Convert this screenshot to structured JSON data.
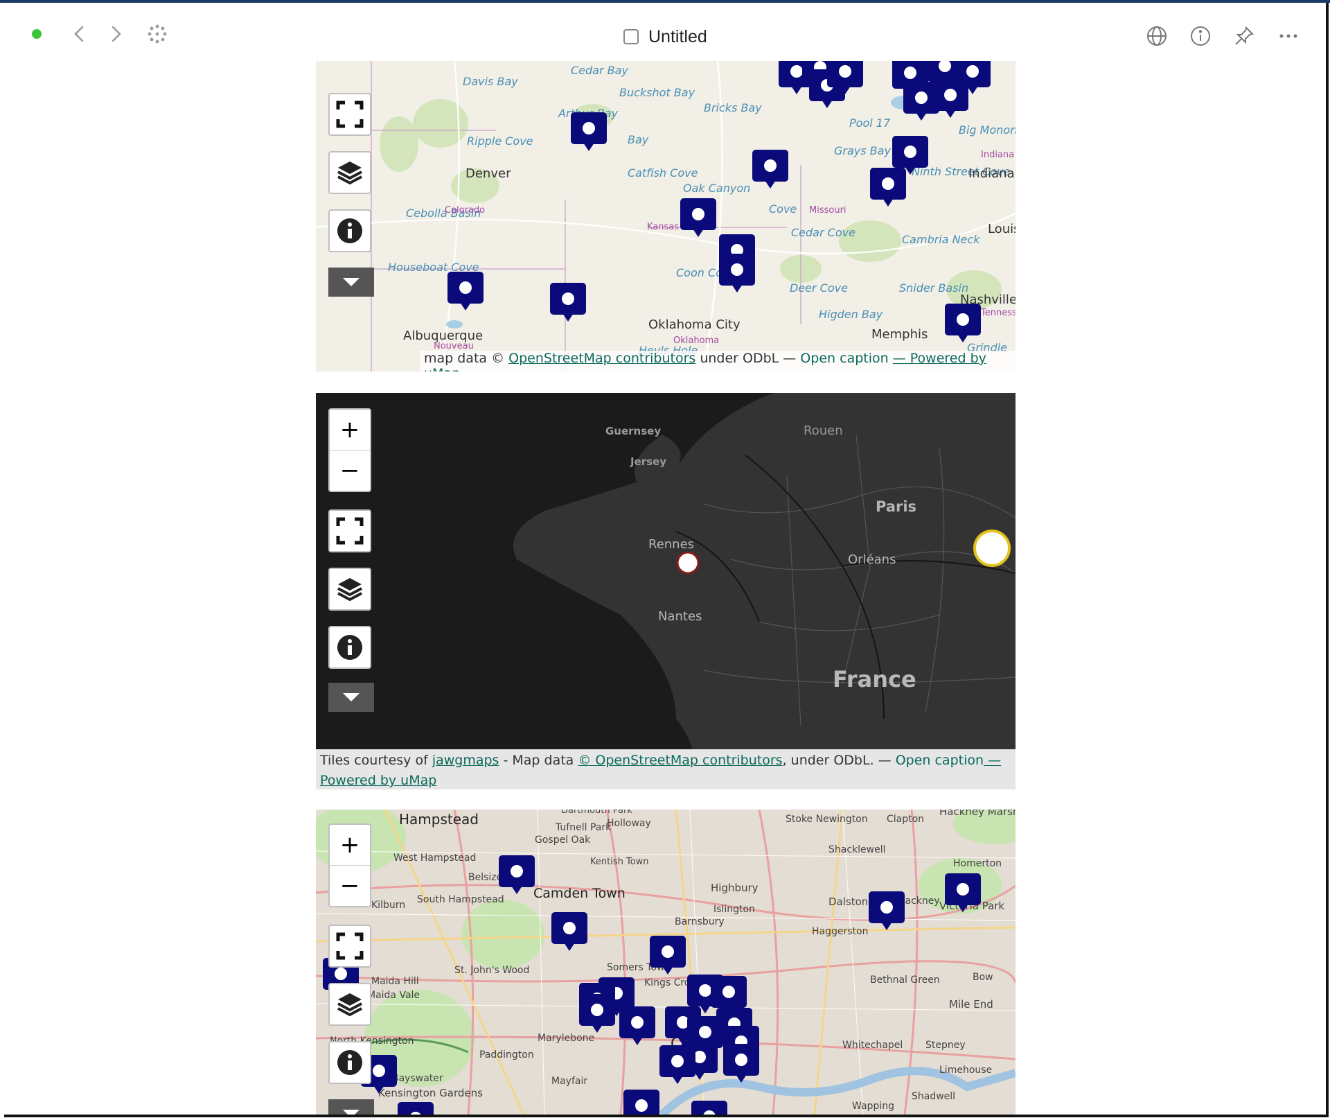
{
  "window": {
    "title": "Untitled"
  },
  "toolbar": {
    "back_icon": "chevron-left-icon",
    "forward_icon": "chevron-right-icon",
    "apps_icon": "dots-grid-icon",
    "globe_icon": "globe-icon",
    "info_icon": "info-circle-icon",
    "pin_icon": "pin-icon",
    "more_icon": "ellipsis-icon"
  },
  "map_controls": {
    "zoom_in": "+",
    "zoom_out": "−"
  },
  "maps": [
    {
      "labels_water": [
        "Davis Bay",
        "Cedar Bay",
        "Buckshot Bay",
        "Bricks Bay",
        "Arthur Bay",
        "Ripple Cove",
        "Bay",
        "Catfish Cove",
        "Oak Canyon",
        "Pool 17",
        "Grays Bay",
        "Big Monon Bay",
        "Ninth Street Cove",
        "Cebolla Basin",
        "Cedar Cove",
        "Cambria Neck",
        "Houseboat Cove",
        "Coon Cove",
        "Deer Cove",
        "Snider Basin",
        "Higden Bay",
        "Cove",
        "Grindle",
        "Hevls Hole"
      ],
      "labels_city": [
        "Denver",
        "Indianapolis",
        "Louisville",
        "Oklahoma City",
        "Albuquerque",
        "Memphis",
        "Nashville"
      ],
      "labels_state": [
        "Colorado",
        "Kansas",
        "Missouri",
        "Indiana",
        "Oklahoma",
        "Nouveau",
        "Tennessee"
      ],
      "attribution": {
        "prefix": "map data © ",
        "osm_link": "OpenStreetMap contributors",
        "middle": " under ODbL — ",
        "open_caption": "Open caption",
        "powered": "— Powered by uMap"
      }
    },
    {
      "labels_region": [
        "Guernsey",
        "Jersey",
        "Rouen",
        "Paris",
        "Rennes",
        "Orléans",
        "Nantes",
        "France"
      ],
      "attribution": {
        "prefix": "Tiles courtesy of ",
        "jawg_link": "jawgmaps",
        "middle": " - Map data ",
        "osm_link": "© OpenStreetMap contributors",
        "suffix": ", under ODbL. — ",
        "open_caption": "Open caption",
        "powered_dash": " —",
        "powered": "Powered by uMap"
      }
    },
    {
      "labels": [
        "Hampstead",
        "Dartmouth Park",
        "Tufnell Park",
        "Holloway",
        "Stoke Newington",
        "Clapton",
        "Hackney Marshes",
        "Gospel Oak",
        "West Hampstead",
        "Shacklewell",
        "Belsize Park",
        "Kentish Town",
        "Homerton",
        "South Hampstead",
        "Camden Town",
        "Highbury",
        "Dalston",
        "Hackney",
        "Kilburn",
        "Islington",
        "Barnsbury",
        "Haggerston",
        "Victoria Park",
        "St. John's Wood",
        "Somers Town",
        "Kings Cross",
        "Bethnal Green",
        "Bow",
        "Maida Hill",
        "Maida Vale",
        "Mile End",
        "North Kensington",
        "Marylebone",
        "Whitechapel",
        "Stepney",
        "Paddington",
        "Limehouse",
        "Bayswater",
        "Kensington Gardens",
        "Mayfair",
        "Shadwell",
        "Wapping",
        "City"
      ]
    }
  ]
}
